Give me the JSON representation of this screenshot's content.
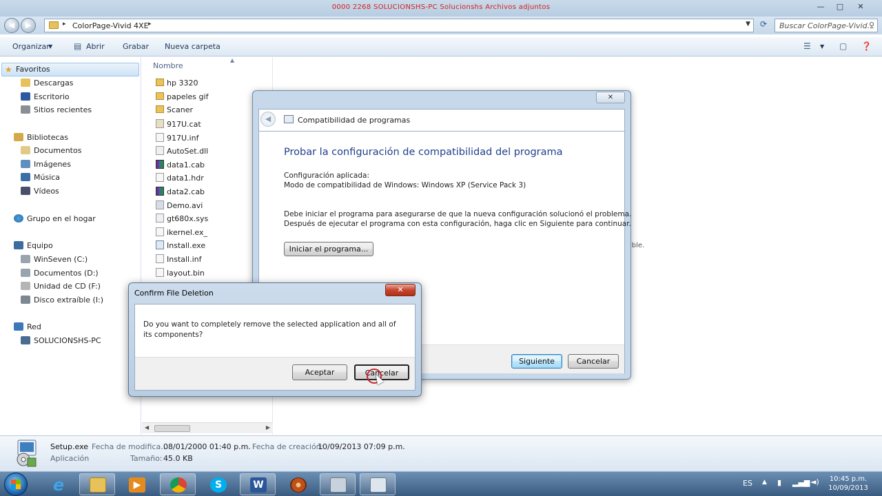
{
  "window": {
    "title": "0000 2268 SOLUCIONSHS-PC Solucionshs Archivos adjuntos",
    "minimize": "—",
    "maximize": "□",
    "close": "✕"
  },
  "address": {
    "path_segment": "ColorPage-Vivid 4XE",
    "search_placeholder": "Buscar ColorPage-Vivid..."
  },
  "toolbar": {
    "organize": "Organizar",
    "open": "Abrir",
    "burn": "Grabar",
    "new_folder": "Nueva carpeta"
  },
  "sidebar": {
    "favorites": "Favoritos",
    "downloads": "Descargas",
    "desktop": "Escritorio",
    "recent": "Sitios recientes",
    "libraries": "Bibliotecas",
    "documents": "Documentos",
    "images": "Imágenes",
    "music": "Música",
    "videos": "Vídeos",
    "homegroup": "Grupo en el hogar",
    "computer": "Equipo",
    "drive_c": "WinSeven (C:)",
    "drive_d": "Documentos (D:)",
    "drive_f": "Unidad de CD (F:)",
    "drive_i": "Disco extraíble (I:)",
    "network": "Red",
    "pc": "SOLUCIONSHS-PC"
  },
  "filelist": {
    "column_name": "Nombre",
    "files": [
      "hp 3320",
      "papeles gif",
      "Scaner",
      "917U.cat",
      "917U.inf",
      "AutoSet.dll",
      "data1.cab",
      "data1.hdr",
      "data2.cab",
      "Demo.avi",
      "gt680x.sys",
      "ikernel.ex_",
      "Install.exe",
      "Install.inf",
      "layout.bin"
    ]
  },
  "background_text": "ible.",
  "details": {
    "name": "Setup.exe",
    "type": "Aplicación",
    "modified_label": "Fecha de modifica...",
    "modified_value": "08/01/2000 01:40 p.m.",
    "created_label": "Fecha de creación:",
    "created_value": "10/09/2013 07:09 p.m.",
    "size_label": "Tamaño:",
    "size_value": "45.0 KB"
  },
  "compat_dialog": {
    "close": "✕",
    "header": "Compatibilidad de programas",
    "title": "Probar la configuración de compatibilidad del programa",
    "applied_label": "Configuración aplicada:",
    "applied_value": "Modo de compatibilidad de Windows: Windows XP (Service Pack 3)",
    "instruction_1": "Debe iniciar el programa para asegurarse de que la nueva configuración solucionó el problema.",
    "instruction_2": "Después de ejecutar el programa con esta configuración, haga clic en Siguiente para continuar.",
    "start_button": "Iniciar el programa...",
    "next_button": "Siguiente",
    "cancel_button": "Cancelar"
  },
  "confirm_dialog": {
    "title": "Confirm File Deletion",
    "close": "✕",
    "message": "Do you want to completely remove the selected application and all of its components?",
    "accept_button": "Aceptar",
    "cancel_button": "Cancelar"
  },
  "taskbar": {
    "language": "ES",
    "time": "10:45 p.m.",
    "date": "10/09/2013",
    "ie_glyph": "e",
    "skype_glyph": "S",
    "word_glyph": "W"
  }
}
